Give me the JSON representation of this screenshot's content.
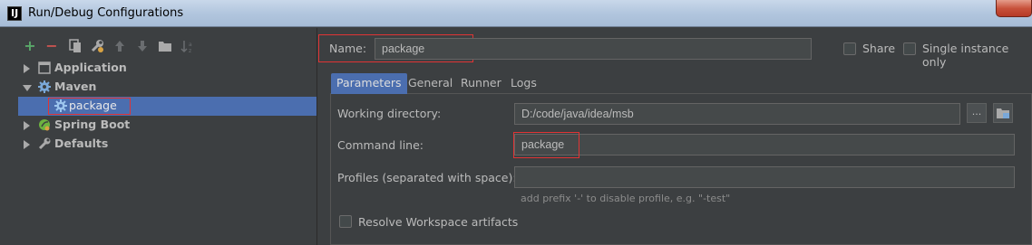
{
  "window": {
    "title": "Run/Debug Configurations",
    "app_icon_letter": "IJ"
  },
  "toolbar": {
    "icons": [
      "add-icon",
      "remove-icon",
      "copy-icon",
      "wrench-icon",
      "move-up-icon",
      "move-down-icon",
      "folder-icon",
      "sort-icon"
    ]
  },
  "tree": {
    "items": [
      {
        "label": "Application",
        "expanded": false
      },
      {
        "label": "Maven",
        "expanded": true
      },
      {
        "label": "package",
        "selected": true
      },
      {
        "label": "Spring Boot",
        "expanded": false
      },
      {
        "label": "Defaults",
        "expanded": false
      }
    ]
  },
  "config": {
    "name_label": "Name:",
    "name_value": "package",
    "share_label": "Share",
    "single_instance_label": "Single instance only"
  },
  "tabs": [
    "Parameters",
    "General",
    "Runner",
    "Logs"
  ],
  "parameters": {
    "working_directory_label": "Working directory:",
    "working_directory_value": "D:/code/java/idea/msb",
    "browse_label": "...",
    "command_line_label": "Command line:",
    "command_line_value": "package",
    "profiles_label": "Profiles (separated with space):",
    "profiles_value": "",
    "profiles_hint": "add prefix '-' to disable profile, e.g. \"-test\"",
    "resolve_workspace_label": "Resolve Workspace artifacts"
  },
  "colors": {
    "background": "#3c3f41",
    "selection": "#4b6eaf",
    "highlight_red": "#e03434",
    "add_green": "#59a869",
    "remove_red": "#c75450"
  }
}
